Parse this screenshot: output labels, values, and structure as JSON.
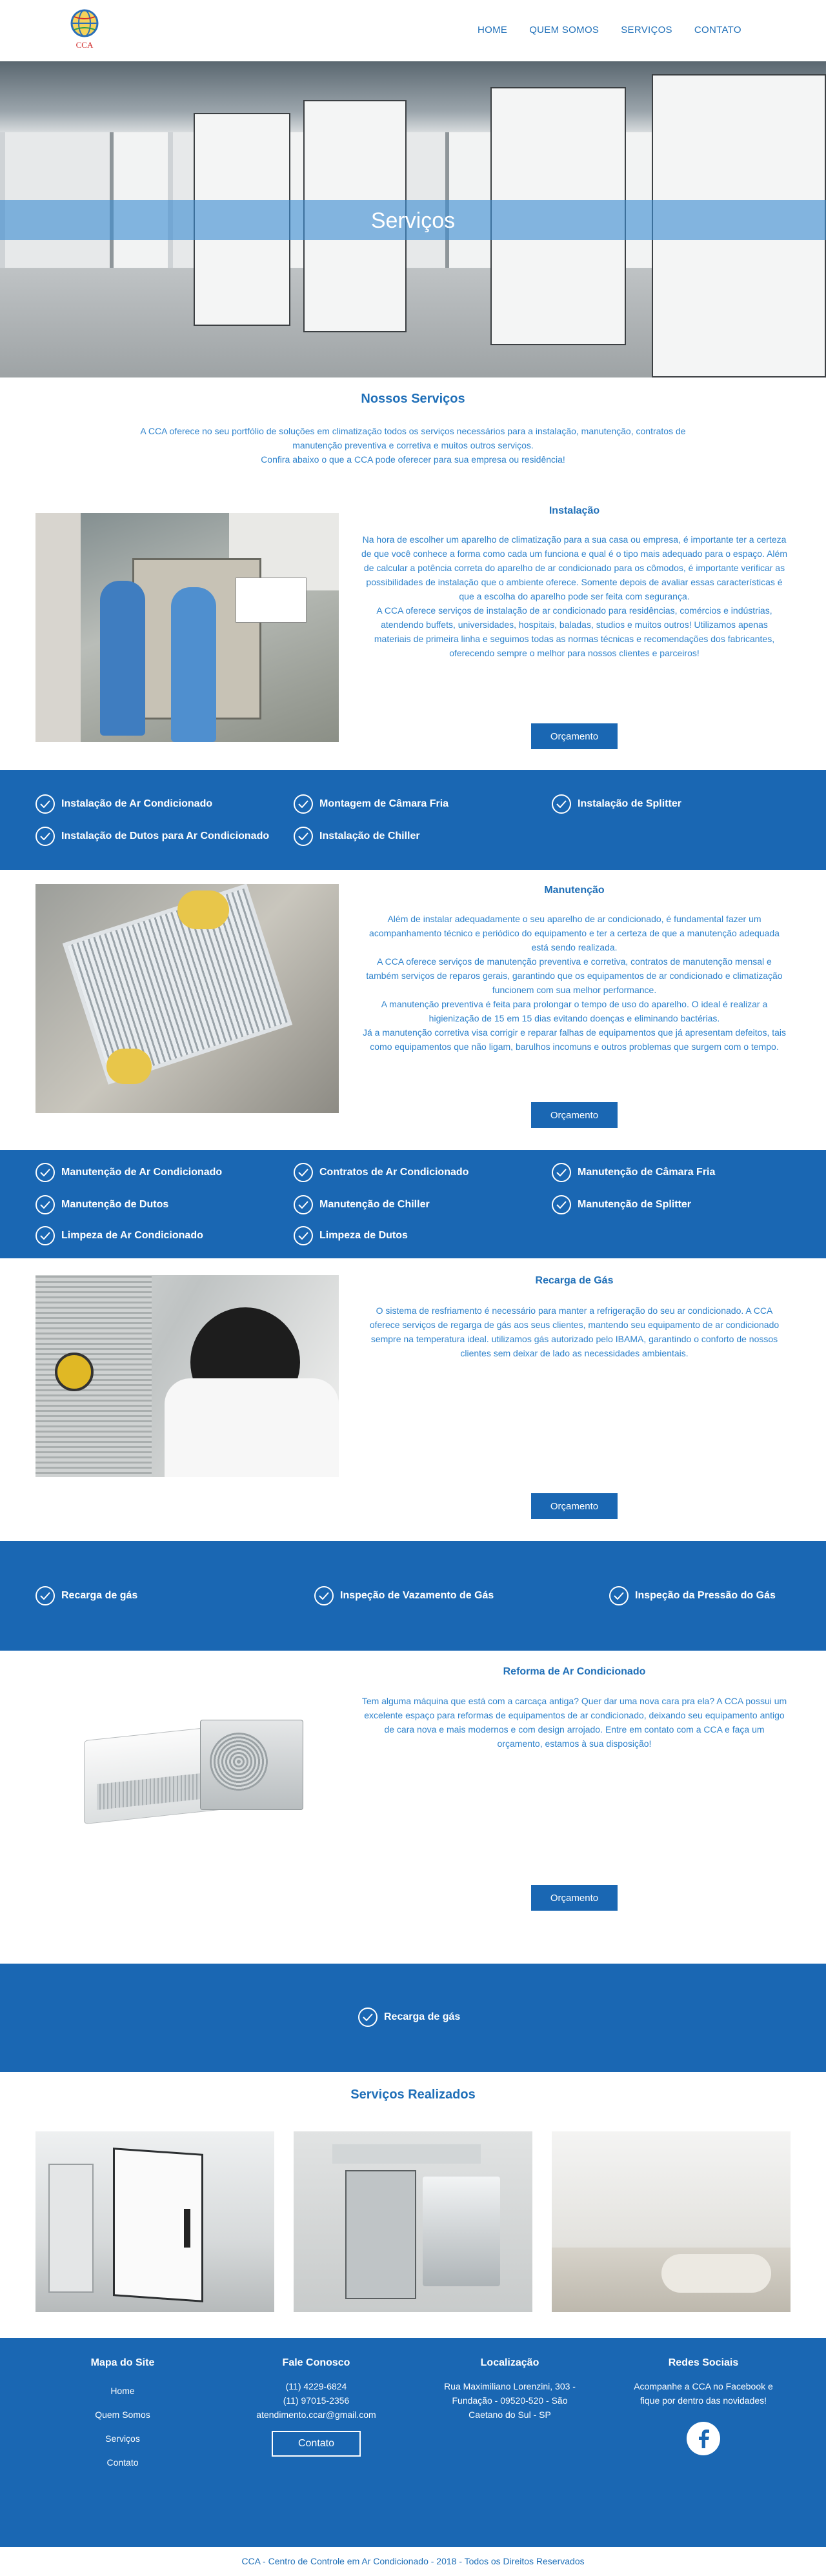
{
  "brand": {
    "logo_text": "CCA"
  },
  "nav": {
    "items": [
      "HOME",
      "QUEM SOMOS",
      "SERVIÇOS",
      "CONTATO"
    ]
  },
  "hero": {
    "title": "Serviços"
  },
  "intro": {
    "title": "Nossos Serviços",
    "lines": [
      "A CCA oferece no seu portfólio de soluções em climatização todos os serviços necessários para a instalação, manutenção, contratos de",
      "manutenção preventiva e corretiva e muitos outros serviços.",
      "Confira abaixo o que a CCA pode oferecer para sua empresa ou residência!"
    ]
  },
  "services": [
    {
      "title": "Instalação",
      "paragraphs": [
        "Na hora de escolher um aparelho de climatização para a sua casa ou empresa, é importante ter a certeza de que você conhece a forma como cada um funciona e qual é o tipo mais adequado para o espaço. Além de calcular a potência correta do aparelho de ar condicionado para os cômodos, é importante verificar as possibilidades de instalação que o ambiente oferece. Somente depois de avaliar essas características é que a escolha do aparelho pode ser feita com segurança.",
        "A CCA oferece serviços de instalação de ar condicionado para residências, comércios e indústrias, atendendo buffets, universidades, hospitais, baladas, studios e muitos outros! Utilizamos apenas materiais de primeira linha e seguimos todas as normas técnicas e recomendações dos fabricantes, oferecendo sempre o melhor para nossos clientes e parceiros!"
      ],
      "button": "Orçamento",
      "features": [
        "Instalação de Ar Condicionado",
        "Montagem de Câmara Fria",
        "Instalação de Splitter",
        "Instalação de Dutos para Ar Condicionado",
        "Instalação de Chiller"
      ]
    },
    {
      "title": "Manutenção",
      "paragraphs": [
        "Além de instalar adequadamente o seu aparelho de ar condicionado, é fundamental fazer um acompanhamento técnico e periódico do equipamento e ter a certeza de que a manutenção adequada está sendo realizada.",
        "A CCA oferece serviços de manutenção preventiva e corretiva, contratos de manutenção mensal e também serviços de reparos gerais, garantindo que os equipamentos de ar condicionado e climatização funcionem com sua melhor performance.",
        "A manutenção preventiva é feita para prolongar o tempo de uso do aparelho. O ideal é realizar a higienização de 15 em 15 dias evitando doenças e eliminando bactérias.",
        "Já a manutenção corretiva visa corrigir e reparar falhas de equipamentos que já apresentam defeitos, tais como equipamentos que não ligam, barulhos incomuns e outros problemas que surgem com o tempo."
      ],
      "button": "Orçamento",
      "features": [
        "Manutenção de Ar Condicionado",
        "Contratos de Ar Condicionado",
        "Manutenção de Câmara Fria",
        "Manutenção de Dutos",
        "Manutenção de Chiller",
        "Manutenção de Splitter",
        "Limpeza de Ar Condicionado",
        "Limpeza de Dutos"
      ]
    },
    {
      "title": "Recarga de Gás",
      "paragraphs": [
        "O sistema de resfriamento é necessário para manter a refrigeração do seu ar condicionado. A CCA oferece serviços de regarga de gás aos seus clientes, mantendo seu equipamento de ar condicionado sempre na temperatura ideal. utilizamos gás autorizado pelo IBAMA, garantindo o conforto de nossos clientes sem deixar de lado as necessidades ambientais."
      ],
      "button": "Orçamento",
      "features": [
        "Recarga de gás",
        "Inspeção de Vazamento de Gás",
        "Inspeção da Pressão do Gás"
      ]
    },
    {
      "title": "Reforma de Ar Condicionado",
      "paragraphs": [
        "Tem alguma máquina que está com a carcaça antiga? Quer dar uma nova cara pra ela? A CCA possui um excelente espaço para reformas de equipamentos de ar condicionado, deixando seu equipamento antigo de cara nova e mais modernos e com design arrojado. Entre em contato com a CCA e faça um orçamento, estamos à sua disposição!"
      ],
      "button": "Orçamento",
      "features": [
        "Recarga de gás"
      ]
    }
  ],
  "gallery": {
    "title": "Serviços Realizados"
  },
  "footer": {
    "sitemap": {
      "title": "Mapa do Site",
      "links": [
        "Home",
        "Quem Somos",
        "Serviços",
        "Contato"
      ]
    },
    "contact": {
      "title": "Fale Conosco",
      "phone1": "(11) 4229-6824",
      "phone2": "(11) 97015-2356",
      "email": "atendimento.ccar@gmail.com",
      "button": "Contato"
    },
    "location": {
      "title": "Localização",
      "lines": [
        "Rua Maximiliano Lorenzini, 303 -",
        "Fundação - 09520-520 - São",
        "Caetano do Sul - SP"
      ]
    },
    "social": {
      "title": "Redes Sociais",
      "lines": [
        "Acompanhe a CCA no Facebook e",
        "fique por dentro das novidades!"
      ]
    },
    "copyright": "CCA - Centro de Controle em Ar Condicionado - 2018 - Todos os Direitos Reservados"
  },
  "colors": {
    "primary": "#1a67b3",
    "text": "#1f6fb8",
    "band_overlay": "#3c8cd2"
  },
  "icons": {
    "check": "check-circle-icon",
    "facebook": "facebook-icon"
  }
}
